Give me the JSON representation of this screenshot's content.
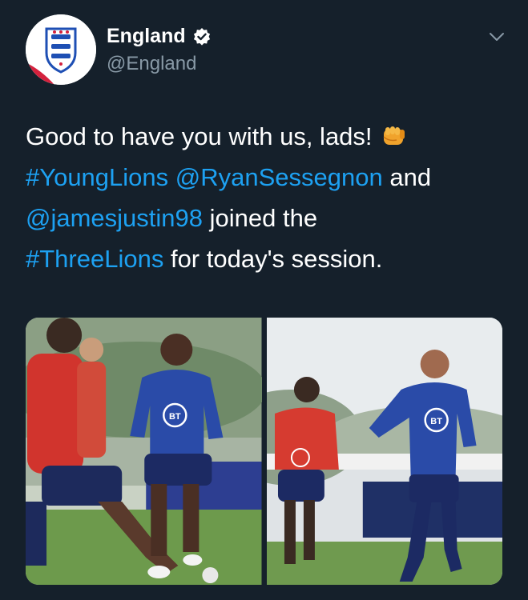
{
  "account": {
    "display_name": "England",
    "handle": "@England",
    "verified": true,
    "verified_icon": "verified-badge-icon",
    "avatar_icon": "three-lions-crest-icon"
  },
  "tweet": {
    "line1_text": "Good to have you with us, lads!",
    "line1_emoji": "fist-bump-emoji",
    "line2": {
      "tag_young_lions": "#YoungLions",
      "mention_ryan": "@RyanSessegnon",
      "and_text": " and"
    },
    "line3": {
      "mention_james": "@jamesjustin98",
      "joined_text": " joined the"
    },
    "line4": {
      "tag_three_lions": "#ThreeLions",
      "session_text": " for today's session."
    }
  },
  "media": {
    "photo_count": 2,
    "photo1_jersey_logo": "BT",
    "photo2_jersey_logo": "BT"
  },
  "colors": {
    "background": "#15202b",
    "text": "#ffffff",
    "secondary": "#8899a6",
    "link": "#1da1f2"
  }
}
